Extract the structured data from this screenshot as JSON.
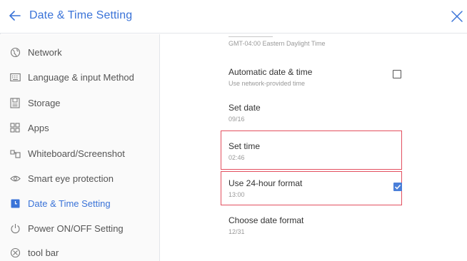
{
  "header": {
    "title": "Date & Time Setting"
  },
  "sidebar": {
    "items": [
      {
        "label": "Network",
        "icon": "globe-icon"
      },
      {
        "label": "Language & input Method",
        "icon": "keyboard-icon"
      },
      {
        "label": "Storage",
        "icon": "storage-icon"
      },
      {
        "label": "Apps",
        "icon": "apps-grid-icon"
      },
      {
        "label": "Whiteboard/Screenshot",
        "icon": "whiteboard-icon"
      },
      {
        "label": "Smart eye protection",
        "icon": "eye-icon"
      },
      {
        "label": "Date & Time Setting",
        "icon": "clock-icon",
        "active": true
      },
      {
        "label": "Power ON/OFF Setting",
        "icon": "power-icon"
      },
      {
        "label": "tool bar",
        "icon": "toolbar-icon"
      }
    ]
  },
  "settings": {
    "timezone_value": "GMT-04:00 Eastern Daylight Time",
    "auto_title": "Automatic date & time",
    "auto_sub": "Use network-provided time",
    "auto_checked": false,
    "setdate_title": "Set date",
    "setdate_value": "09/16",
    "settime_title": "Set time",
    "settime_value": "02:46",
    "h24_title": "Use 24-hour format",
    "h24_value": "13:00",
    "h24_checked": true,
    "dateformat_title": "Choose date format",
    "dateformat_value": "12/31"
  },
  "colors": {
    "accent": "#3a73d8",
    "highlight": "#e3505f"
  }
}
